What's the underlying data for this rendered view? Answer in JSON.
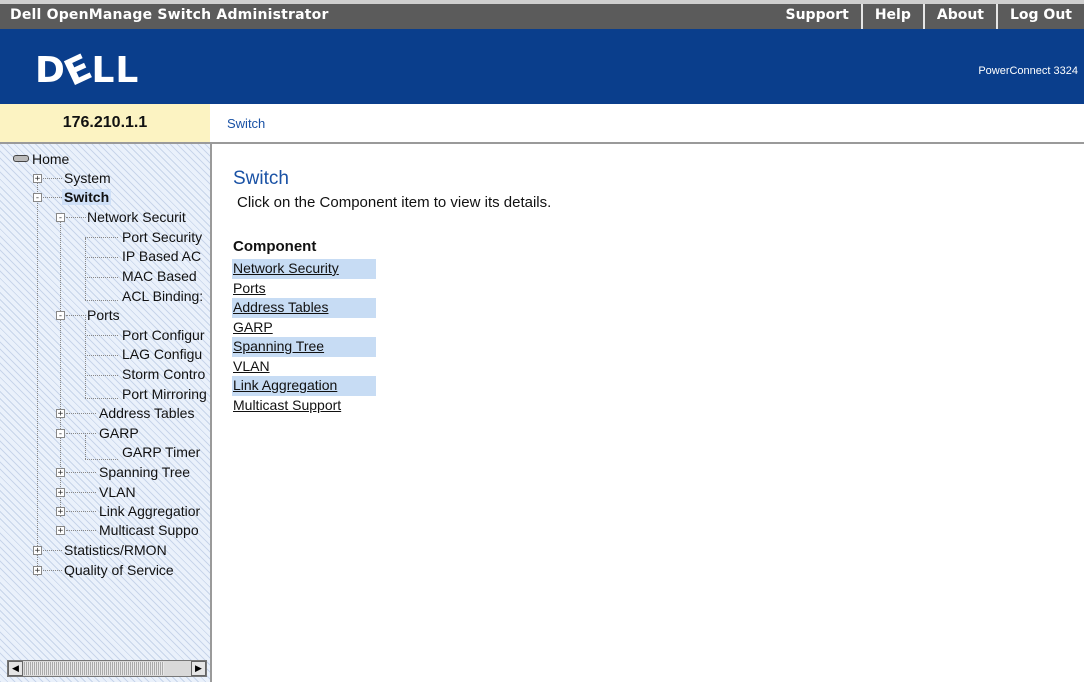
{
  "header": {
    "title": "Dell OpenManage Switch Administrator",
    "nav": [
      "Support",
      "Help",
      "About",
      "Log Out"
    ]
  },
  "brand": {
    "logo_text": "DELL",
    "product": "PowerConnect 3324",
    "color": "#0a3e8c"
  },
  "ip_address": "176.210.1.1",
  "breadcrumb": "Switch",
  "tree": {
    "root": "Home",
    "items": [
      {
        "label": "System",
        "toggle": "+"
      },
      {
        "label": "Switch",
        "toggle": "-"
      },
      {
        "label": "Network Securit",
        "toggle": "-"
      },
      {
        "label": "Port Security",
        "toggle": ""
      },
      {
        "label": "IP Based AC",
        "toggle": ""
      },
      {
        "label": "MAC Based",
        "toggle": ""
      },
      {
        "label": "ACL Binding:",
        "toggle": ""
      },
      {
        "label": "Ports",
        "toggle": "-"
      },
      {
        "label": "Port Configur",
        "toggle": ""
      },
      {
        "label": "LAG Configu",
        "toggle": ""
      },
      {
        "label": "Storm Contro",
        "toggle": ""
      },
      {
        "label": "Port Mirroring",
        "toggle": ""
      },
      {
        "label": "Address Tables",
        "toggle": "+"
      },
      {
        "label": "GARP",
        "toggle": "-"
      },
      {
        "label": "GARP Timer",
        "toggle": ""
      },
      {
        "label": "Spanning Tree",
        "toggle": "+"
      },
      {
        "label": "VLAN",
        "toggle": "+"
      },
      {
        "label": "Link Aggregatior",
        "toggle": "+"
      },
      {
        "label": "Multicast Suppo",
        "toggle": "+"
      },
      {
        "label": "Statistics/RMON",
        "toggle": "+"
      },
      {
        "label": "Quality of Service",
        "toggle": "+"
      }
    ]
  },
  "main": {
    "title": "Switch",
    "description": "Click on the Component item to view its details.",
    "component_header": "Component",
    "components": [
      "Network Security",
      "Ports",
      "Address Tables",
      "GARP",
      "Spanning Tree",
      "VLAN",
      "Link Aggregation",
      "Multicast Support"
    ]
  }
}
